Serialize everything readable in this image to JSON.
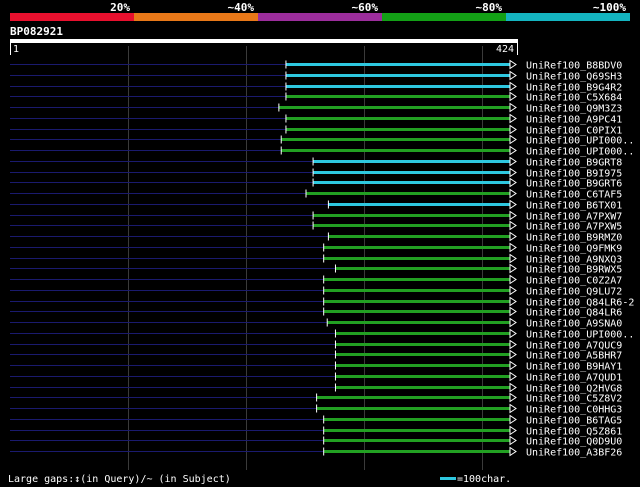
{
  "header": {
    "scale_labels": [
      "20%",
      "~40%",
      "~60%",
      "~80%",
      "~100%"
    ],
    "scale_colors": [
      "#e8102e",
      "#e87818",
      "#9c2d9c",
      "#13a016",
      "#14b4c0"
    ],
    "query_id": "BP082921",
    "query_start": "1",
    "query_end": "424"
  },
  "footer": {
    "gap_legend": "Large gaps:↕(in Query)/~ (in Subject)",
    "scale_legend": "=100char."
  },
  "colors": {
    "background": "#000000",
    "query_line": "#ffffff",
    "connector": "#1a1a6e",
    "grid": "#3a3a3a",
    "cyan": "#2ec8e0",
    "green": "#22a022"
  },
  "chart_data": {
    "type": "alignment",
    "query_length": 424,
    "hits": [
      {
        "name": "UniRef100_B8BDV0",
        "start": 234,
        "end": 424,
        "color": "cyan"
      },
      {
        "name": "UniRef100_Q69SH3",
        "start": 234,
        "end": 424,
        "color": "cyan"
      },
      {
        "name": "UniRef100_B9G4R2",
        "start": 234,
        "end": 424,
        "color": "cyan"
      },
      {
        "name": "UniRef100_C5X684",
        "start": 234,
        "end": 424,
        "color": "green"
      },
      {
        "name": "UniRef100_Q9M3Z3",
        "start": 228,
        "end": 424,
        "color": "green"
      },
      {
        "name": "UniRef100_A9PC41",
        "start": 234,
        "end": 424,
        "color": "green"
      },
      {
        "name": "UniRef100_C0PIX1",
        "start": 234,
        "end": 424,
        "color": "green"
      },
      {
        "name": "UniRef100_UPI000..",
        "start": 230,
        "end": 424,
        "color": "green"
      },
      {
        "name": "UniRef100_UPI000..",
        "start": 230,
        "end": 424,
        "color": "green"
      },
      {
        "name": "UniRef100_B9GRT8",
        "start": 257,
        "end": 424,
        "color": "cyan"
      },
      {
        "name": "UniRef100_B9I975",
        "start": 257,
        "end": 424,
        "color": "cyan"
      },
      {
        "name": "UniRef100_B9GRT6",
        "start": 257,
        "end": 424,
        "color": "cyan"
      },
      {
        "name": "UniRef100_C6TAF5",
        "start": 251,
        "end": 424,
        "color": "green"
      },
      {
        "name": "UniRef100_B6TX01",
        "start": 270,
        "end": 424,
        "color": "cyan"
      },
      {
        "name": "UniRef100_A7PXW7",
        "start": 257,
        "end": 424,
        "color": "green"
      },
      {
        "name": "UniRef100_A7PXW5",
        "start": 257,
        "end": 424,
        "color": "green"
      },
      {
        "name": "UniRef100_B9RMZ0",
        "start": 270,
        "end": 424,
        "color": "green"
      },
      {
        "name": "UniRef100_Q9FMK9",
        "start": 266,
        "end": 424,
        "color": "green"
      },
      {
        "name": "UniRef100_A9NXQ3",
        "start": 266,
        "end": 424,
        "color": "green"
      },
      {
        "name": "UniRef100_B9RWX5",
        "start": 276,
        "end": 424,
        "color": "green"
      },
      {
        "name": "UniRef100_C0Z2A7",
        "start": 266,
        "end": 424,
        "color": "green"
      },
      {
        "name": "UniRef100_Q9LU72",
        "start": 266,
        "end": 424,
        "color": "green"
      },
      {
        "name": "UniRef100_Q84LR6-2",
        "start": 266,
        "end": 424,
        "color": "green"
      },
      {
        "name": "UniRef100_Q84LR6",
        "start": 266,
        "end": 424,
        "color": "green"
      },
      {
        "name": "UniRef100_A9SNA0",
        "start": 269,
        "end": 424,
        "color": "green"
      },
      {
        "name": "UniRef100_UPI000..",
        "start": 276,
        "end": 424,
        "color": "green"
      },
      {
        "name": "UniRef100_A7QUC9",
        "start": 276,
        "end": 424,
        "color": "green"
      },
      {
        "name": "UniRef100_A5BHR7",
        "start": 276,
        "end": 424,
        "color": "green"
      },
      {
        "name": "UniRef100_B9HAY1",
        "start": 276,
        "end": 424,
        "color": "green"
      },
      {
        "name": "UniRef100_A7QUD1",
        "start": 276,
        "end": 424,
        "color": "green"
      },
      {
        "name": "UniRef100_Q2HVG8",
        "start": 276,
        "end": 424,
        "color": "green"
      },
      {
        "name": "UniRef100_C5Z8V2",
        "start": 260,
        "end": 424,
        "color": "green"
      },
      {
        "name": "UniRef100_C0HHG3",
        "start": 260,
        "end": 424,
        "color": "green"
      },
      {
        "name": "UniRef100_B6TAG5",
        "start": 266,
        "end": 424,
        "color": "green"
      },
      {
        "name": "UniRef100_Q5Z861",
        "start": 266,
        "end": 424,
        "color": "green"
      },
      {
        "name": "UniRef100_Q0D9U0",
        "start": 266,
        "end": 424,
        "color": "green"
      },
      {
        "name": "UniRef100_A3BF26",
        "start": 266,
        "end": 424,
        "color": "green"
      }
    ]
  }
}
